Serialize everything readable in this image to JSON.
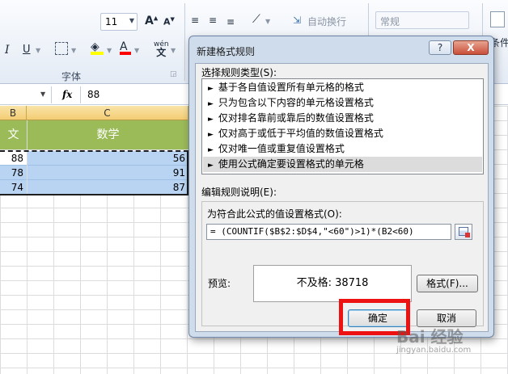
{
  "ribbon": {
    "font_size": "11",
    "group_font_label": "字体",
    "wrap_text_label": "自动换行",
    "number_format_value": "常规",
    "condition_label": "条件"
  },
  "formula_bar": {
    "fx_label": "fx",
    "cell_value": "88"
  },
  "sheet": {
    "col_b": "B",
    "col_c": "C",
    "header_partial": "文",
    "header_math": "数学",
    "rows": [
      {
        "b": "88",
        "c": "56"
      },
      {
        "b": "78",
        "c": "91"
      },
      {
        "b": "74",
        "c": "87"
      }
    ]
  },
  "dialog": {
    "title": "新建格式规则",
    "help_button": "?",
    "close_button": "X",
    "select_type_label": "选择规则类型(S):",
    "rule_types": [
      "基于各自值设置所有单元格的格式",
      "只为包含以下内容的单元格设置格式",
      "仅对排名靠前或靠后的数值设置格式",
      "仅对高于或低于平均值的数值设置格式",
      "仅对唯一值或重复值设置格式",
      "使用公式确定要设置格式的单元格"
    ],
    "edit_desc_label": "编辑规则说明(E):",
    "formula_label": "为符合此公式的值设置格式(O):",
    "formula_value": "= (COUNTIF($B$2:$D$4,\"<60\")>1)*(B2<60)",
    "preview_label": "预览:",
    "preview_text": "不及格: 38718",
    "format_button": "格式(F)...",
    "ok_button": "确定",
    "cancel_button": "取消"
  },
  "watermark": {
    "text": "Bai 经验",
    "url": "jingyan.baidu.com"
  },
  "colors": {
    "highlight": "#ee1111",
    "header_green": "#9bbb59",
    "selection_blue": "#b8d4f2"
  }
}
